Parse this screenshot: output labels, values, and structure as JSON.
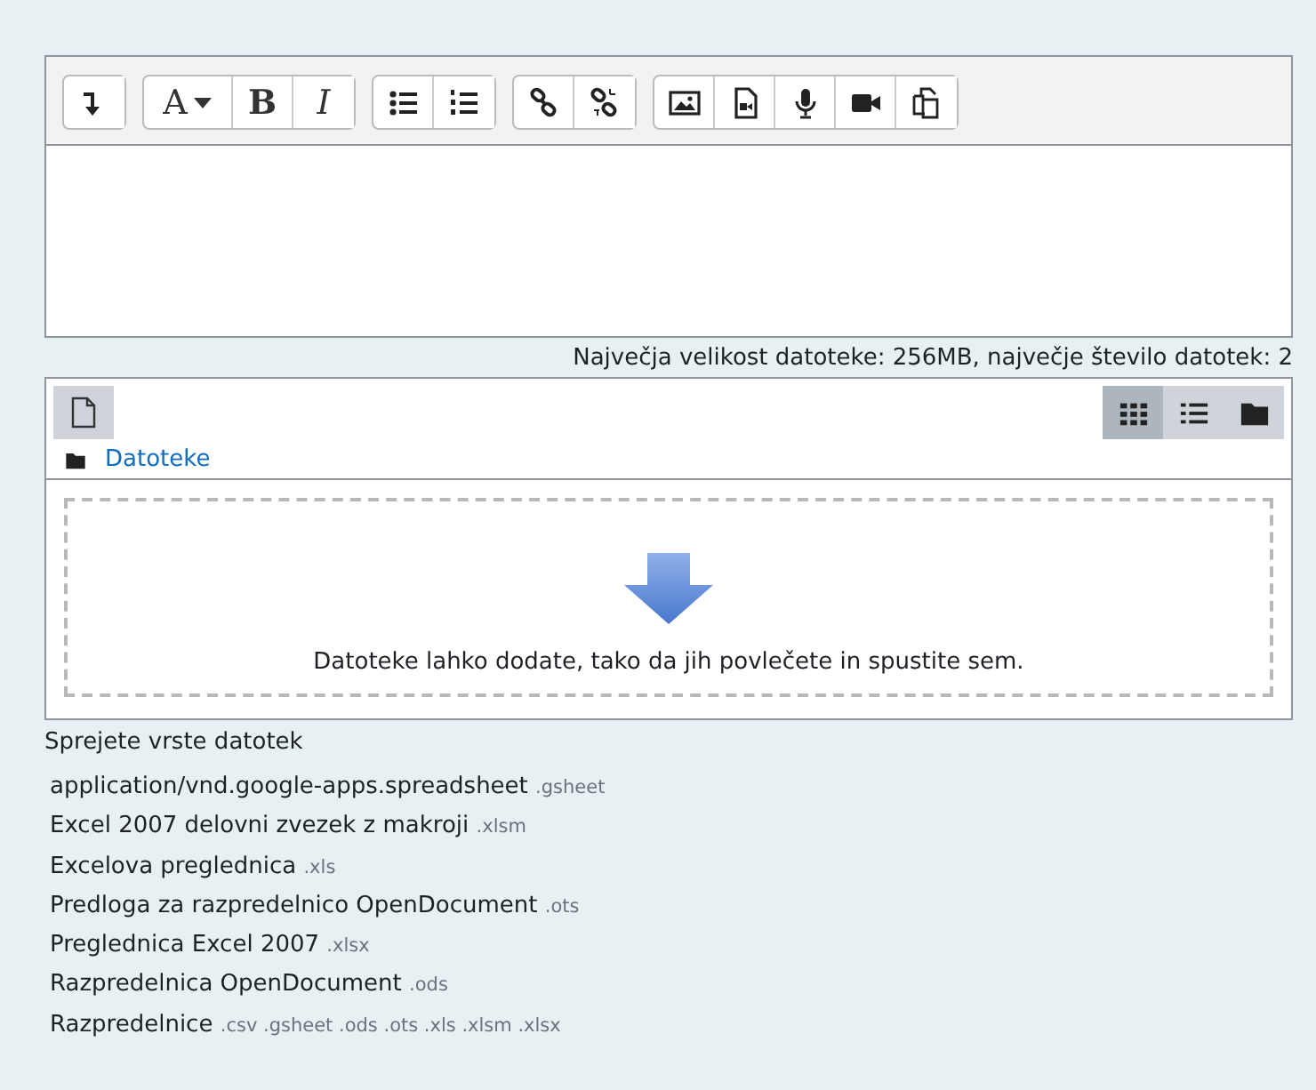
{
  "toolbar": [
    [
      {
        "kind": "collapse"
      }
    ],
    [
      {
        "kind": "font",
        "label": "A"
      },
      {
        "kind": "bold",
        "label": "B"
      },
      {
        "kind": "italic",
        "label": "I"
      }
    ],
    [
      {
        "kind": "bullets"
      },
      {
        "kind": "numbers"
      }
    ],
    [
      {
        "kind": "link"
      },
      {
        "kind": "unlink"
      }
    ],
    [
      {
        "kind": "image"
      },
      {
        "kind": "media"
      },
      {
        "kind": "mic"
      },
      {
        "kind": "video"
      },
      {
        "kind": "copy"
      }
    ]
  ],
  "size_note": "Največja velikost datoteke: 256MB, največje število datotek: 2",
  "file_manager": {
    "views": [
      {
        "kind": "grid",
        "selected": true
      },
      {
        "kind": "list",
        "selected": false
      },
      {
        "kind": "tree",
        "selected": false
      }
    ],
    "path": "Datoteke",
    "drop_hint": "Datoteke lahko dodate, tako da jih povlečete in spustite sem."
  },
  "accepted_title": "Sprejete vrste datotek",
  "accepted": [
    {
      "name": "application/vnd.google-apps.spreadsheet",
      "ext": ".gsheet"
    },
    {
      "name": "Excel 2007 delovni zvezek z makroji",
      "ext": ".xlsm"
    },
    {
      "name": "Excelova preglednica",
      "ext": ".xls"
    },
    {
      "name": "Predloga za razpredelnico OpenDocument",
      "ext": ".ots"
    },
    {
      "name": "Preglednica Excel 2007",
      "ext": ".xlsx"
    },
    {
      "name": "Razpredelnica OpenDocument",
      "ext": ".ods"
    },
    {
      "name": "Razpredelnice",
      "ext": ".csv .gsheet .ods .ots .xls .xlsm .xlsx"
    }
  ]
}
